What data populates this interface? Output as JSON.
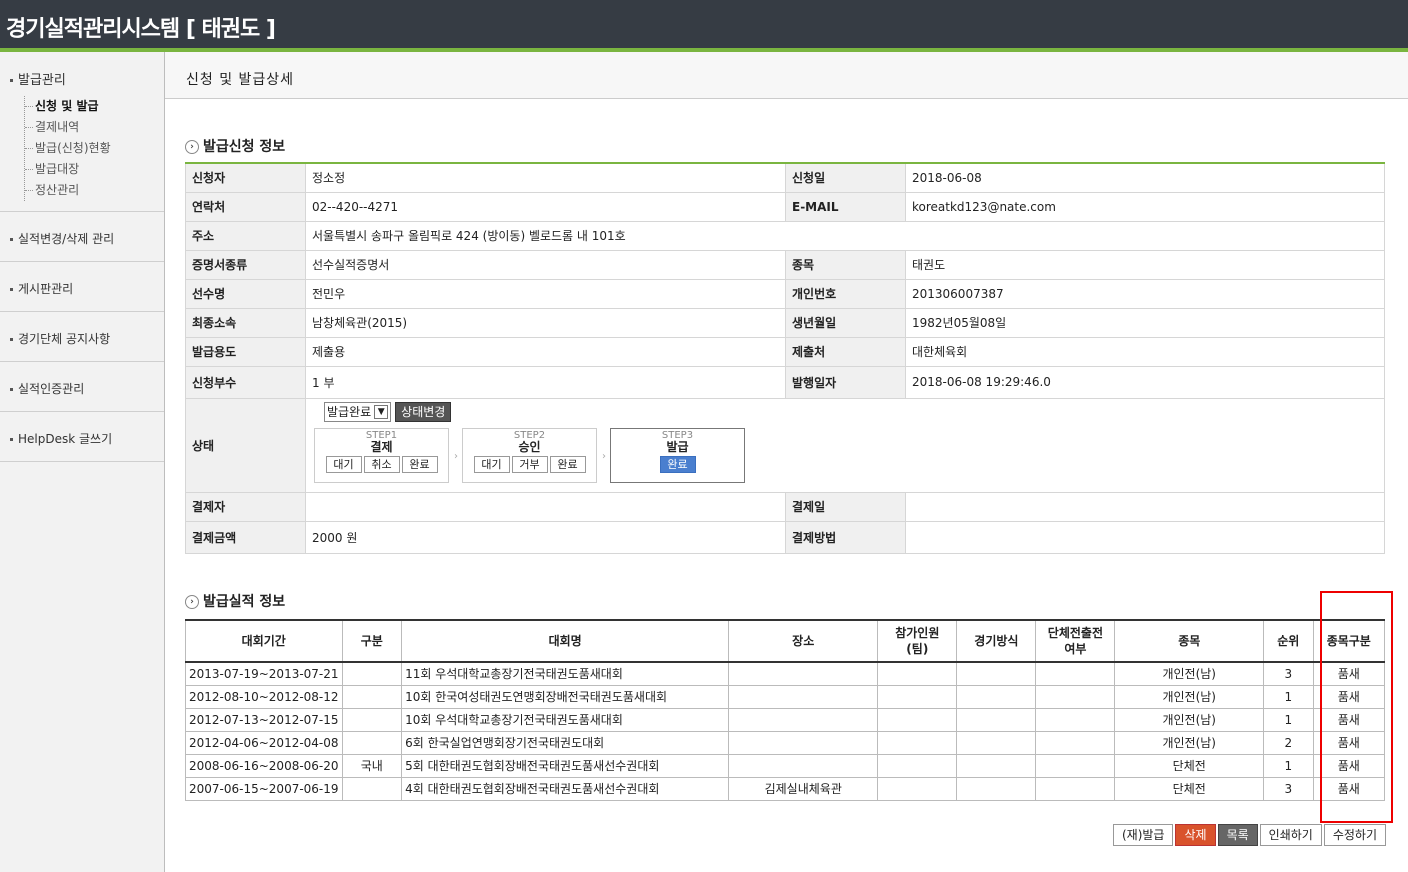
{
  "header": {
    "title": "경기실적관리시스템  [ 태권도 ]"
  },
  "sidebar": {
    "groups": [
      {
        "label": "발급관리",
        "items": [
          "신청 및 발급",
          "결제내역",
          "발급(신청)현황",
          "발급대장",
          "정산관리"
        ]
      },
      {
        "label": "실적변경/삭제 관리"
      },
      {
        "label": "게시판관리"
      },
      {
        "label": "경기단체 공지사항"
      },
      {
        "label": "실적인증관리"
      },
      {
        "label": "HelpDesk 글쓰기"
      }
    ]
  },
  "page_title": "신청 및 발급상세",
  "info_section": {
    "title": "발급신청 정보",
    "applicant_label": "신청자",
    "applicant": "정소정",
    "apply_date_label": "신청일",
    "apply_date": "2018-06-08",
    "contact_label": "연락처",
    "contact": "02--420--4271",
    "email_label": "E-MAIL",
    "email": "koreatkd123@nate.com",
    "address_label": "주소",
    "address": "서울특별시 송파구 올림픽로 424 (방이동) 벨로드롬 내 101호",
    "cert_type_label": "증명서종류",
    "cert_type": "선수실적증명서",
    "sport_label": "종목",
    "sport": "태권도",
    "player_label": "선수명",
    "player": "전민우",
    "personal_no_label": "개인번호",
    "personal_no": "201306007387",
    "affiliation_label": "최종소속",
    "affiliation": "남창체육관(2015)",
    "birth_label": "생년월일",
    "birth": "1982년05월08일",
    "purpose_label": "발급용도",
    "purpose": "제출용",
    "submit_to_label": "제출처",
    "submit_to": "대한체육회",
    "copies_label": "신청부수",
    "copies": "1 부",
    "issue_date_label": "발행일자",
    "issue_date": "2018-06-08 19:29:46.0",
    "status_label": "상태",
    "status_select": "발급완료",
    "status_button": "상태변경",
    "steps": [
      {
        "step": "STEP1",
        "name": "결제",
        "buttons": [
          "대기",
          "취소",
          "완료"
        ]
      },
      {
        "step": "STEP2",
        "name": "승인",
        "buttons": [
          "대기",
          "거부",
          "완료"
        ]
      },
      {
        "step": "STEP3",
        "name": "발급",
        "buttons": [
          "완료"
        ]
      }
    ],
    "payer_label": "결제자",
    "payer": "",
    "pay_date_label": "결제일",
    "pay_date": "",
    "amount_label": "결제금액",
    "amount": "2000 원",
    "pay_method_label": "결제방법",
    "pay_method": ""
  },
  "record_section": {
    "title": "발급실적 정보",
    "headers": [
      "대회기간",
      "구분",
      "대회명",
      "장소",
      "참가인원\n(팀)",
      "경기방식",
      "단체전출전\n여부",
      "종목",
      "순위",
      "종목구분"
    ],
    "rows": [
      [
        "2013-07-19~2013-07-21",
        "",
        "11회 우석대학교총장기전국태권도품새대회",
        "",
        "",
        "",
        "",
        "개인전(남)",
        "3",
        "품새"
      ],
      [
        "2012-08-10~2012-08-12",
        "",
        "10회 한국여성태권도연맹회장배전국태권도품새대회",
        "",
        "",
        "",
        "",
        "개인전(남)",
        "1",
        "품새"
      ],
      [
        "2012-07-13~2012-07-15",
        "",
        "10회 우석대학교총장기전국태권도품새대회",
        "",
        "",
        "",
        "",
        "개인전(남)",
        "1",
        "품새"
      ],
      [
        "2012-04-06~2012-04-08",
        "",
        "6회 한국실업연맹회장기전국태권도대회",
        "",
        "",
        "",
        "",
        "개인전(남)",
        "2",
        "품새"
      ],
      [
        "2008-06-16~2008-06-20",
        "국내",
        "5회 대한태권도협회장배전국태권도품새선수권대회",
        "",
        "",
        "",
        "",
        "단체전",
        "1",
        "품새"
      ],
      [
        "2007-06-15~2007-06-19",
        "",
        "4회 대한태권도협회장배전국태권도품새선수권대회",
        "김제실내체육관",
        "",
        "",
        "",
        "단체전",
        "3",
        "품새"
      ]
    ]
  },
  "actions": {
    "reissue": "(재)발급",
    "delete": "삭제",
    "list": "목록",
    "print": "인쇄하기",
    "edit": "수정하기"
  },
  "colors": {
    "header_bg": "#363c44",
    "accent_green": "#7ab540",
    "highlight_red": "#e00000",
    "delete_btn": "#d9532c"
  }
}
